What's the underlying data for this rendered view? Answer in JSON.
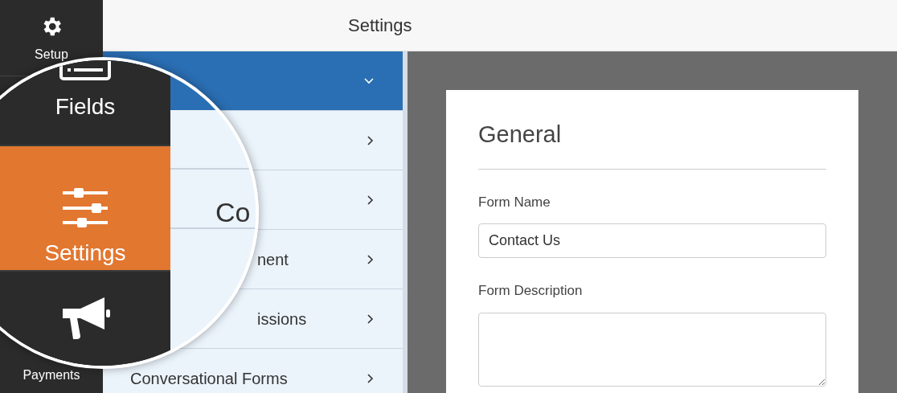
{
  "sidebar": {
    "items": [
      {
        "label": "Setup"
      },
      {
        "label": "Payments"
      }
    ]
  },
  "header": {
    "title": "Settings"
  },
  "submenu": {
    "items": [
      {
        "kind": "hidden",
        "selected": true,
        "expanded": true
      },
      {
        "kind": "hidden",
        "selected": false,
        "expanded": false
      },
      {
        "kind": "hidden",
        "selected": false,
        "expanded": false
      },
      {
        "kind": "cut",
        "label": "nent",
        "selected": false,
        "expanded": false
      },
      {
        "kind": "cut",
        "label": "issions",
        "selected": false,
        "expanded": false
      },
      {
        "kind": "full",
        "label": "Conversational Forms",
        "selected": false,
        "expanded": false
      }
    ]
  },
  "magnifier": {
    "items": [
      {
        "label": "Fields",
        "selected": false
      },
      {
        "label": "Settings",
        "selected": true
      },
      {
        "selected": false
      }
    ],
    "fragment": "Co"
  },
  "form": {
    "title": "General",
    "fields": [
      {
        "kind": "input",
        "label": "Form Name",
        "value": "Contact Us"
      },
      {
        "kind": "textarea",
        "label": "Form Description"
      }
    ]
  }
}
